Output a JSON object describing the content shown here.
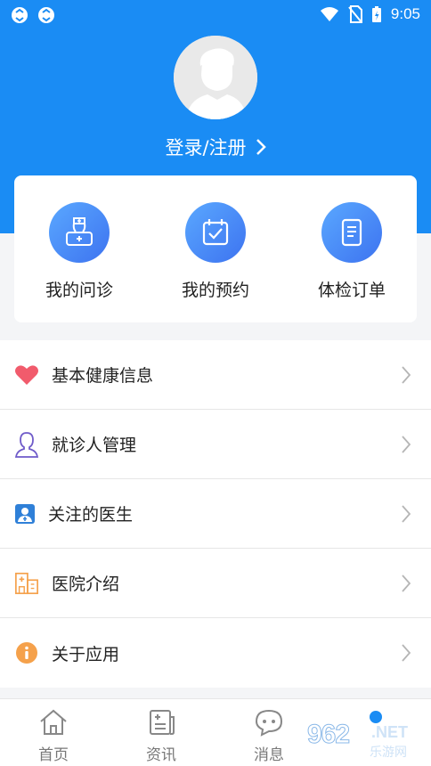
{
  "status_bar": {
    "time": "9:05"
  },
  "profile": {
    "login_label": "登录/注册"
  },
  "quick_actions": [
    {
      "label": "我的问诊",
      "icon": "doctor-consult-icon"
    },
    {
      "label": "我的预约",
      "icon": "calendar-check-icon"
    },
    {
      "label": "体检订单",
      "icon": "document-icon"
    }
  ],
  "menu": [
    {
      "label": "基本健康信息",
      "icon": "heart-icon"
    },
    {
      "label": "就诊人管理",
      "icon": "person-outline-icon"
    },
    {
      "label": "关注的医生",
      "icon": "doctor-badge-icon"
    },
    {
      "label": "医院介绍",
      "icon": "hospital-icon"
    },
    {
      "label": "关于应用",
      "icon": "info-icon"
    }
  ],
  "tabs": [
    {
      "label": "首页",
      "icon": "home-icon"
    },
    {
      "label": "资讯",
      "icon": "news-icon"
    },
    {
      "label": "消息",
      "icon": "message-icon"
    }
  ],
  "watermark": {
    "number": "962",
    "suffix": ".NET",
    "sub": "乐游网"
  },
  "colors": {
    "primary": "#1a8cf4",
    "heart": "#f15b6c",
    "orange": "#f5a14b"
  }
}
